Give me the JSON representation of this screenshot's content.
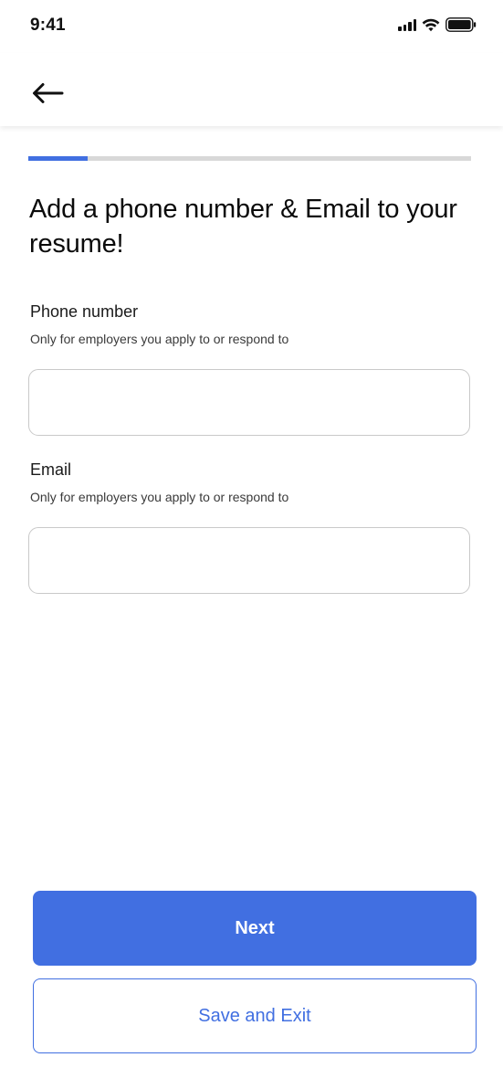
{
  "status_bar": {
    "time": "9:41",
    "icons": [
      "cellular-signal-icon",
      "wifi-icon",
      "battery-icon"
    ]
  },
  "header": {
    "back_icon": "arrow-left-icon"
  },
  "progress": {
    "fraction": 0.135,
    "fill_color": "#416fe1",
    "track_color": "#d8d8d8"
  },
  "title": "Add a phone number & Email to your resume!",
  "form": {
    "phone": {
      "label": "Phone number",
      "hint": "Only for employers you apply to or respond to",
      "value": "",
      "placeholder": ""
    },
    "email": {
      "label": "Email",
      "hint": "Only for employers you apply to or respond to",
      "value": "",
      "placeholder": ""
    }
  },
  "actions": {
    "next_label": "Next",
    "save_exit_label": "Save and Exit"
  },
  "colors": {
    "accent": "#416fe1"
  }
}
